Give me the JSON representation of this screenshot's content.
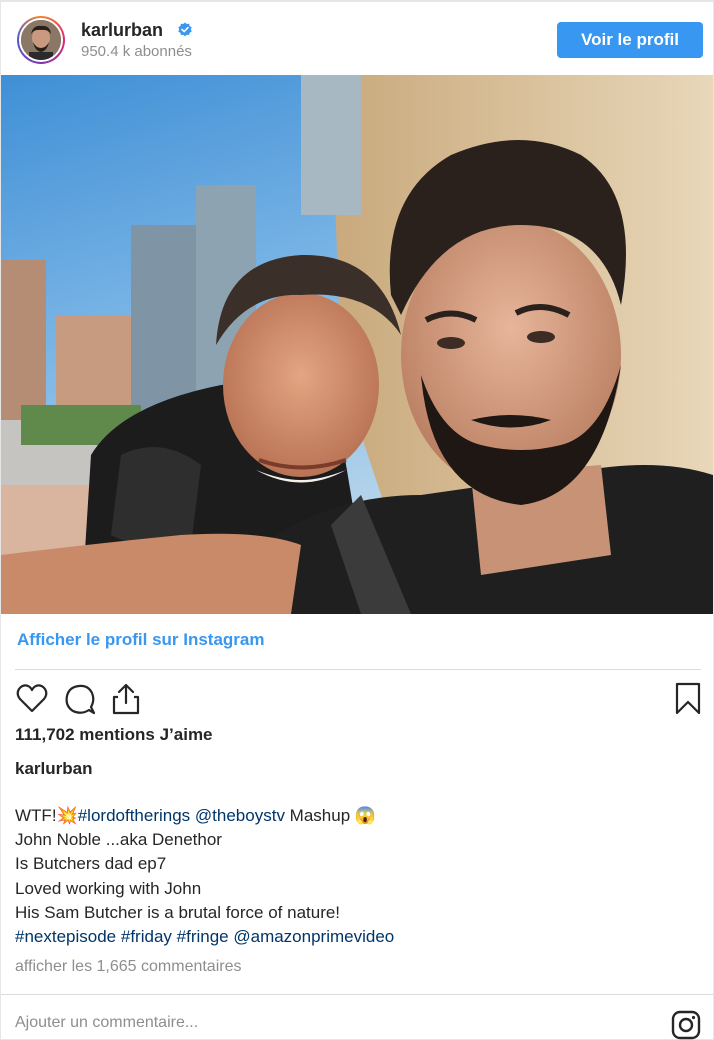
{
  "header": {
    "username": "karlurban",
    "followers": "950.4 k abonnés",
    "profile_button": "Voir le profil",
    "verified_icon": "verified-badge-icon",
    "brand_color": "#3897f0"
  },
  "photo": {
    "icon": "post-photo"
  },
  "view_on_instagram": "Afficher le profil sur Instagram",
  "actions": {
    "like_icon": "heart-icon",
    "comment_icon": "comment-icon",
    "share_icon": "share-icon",
    "save_icon": "bookmark-icon"
  },
  "likes": "111,702 mentions J’aime",
  "author": "karlurban",
  "caption": {
    "line1_prefix": "WTF!",
    "line1_emoji": "💥",
    "line1_tag1": "#lordoftherings",
    "line1_tag2": "@theboystv",
    "line1_suffix": " Mashup ",
    "line1_emoji2": "😱",
    "line2": "John Noble ...aka Denethor",
    "line3": "Is Butchers dad ep7",
    "line4": "Loved working with John",
    "line5": "His Sam Butcher is a brutal force of nature!",
    "tags": [
      "#nextepisode",
      "#friday",
      "#fringe",
      "@amazonprimevideo"
    ]
  },
  "comments_link": "afficher les 1,665 commentaires",
  "comment_placeholder": "Ajouter un commentaire...",
  "instagram_icon": "instagram-logo-icon"
}
